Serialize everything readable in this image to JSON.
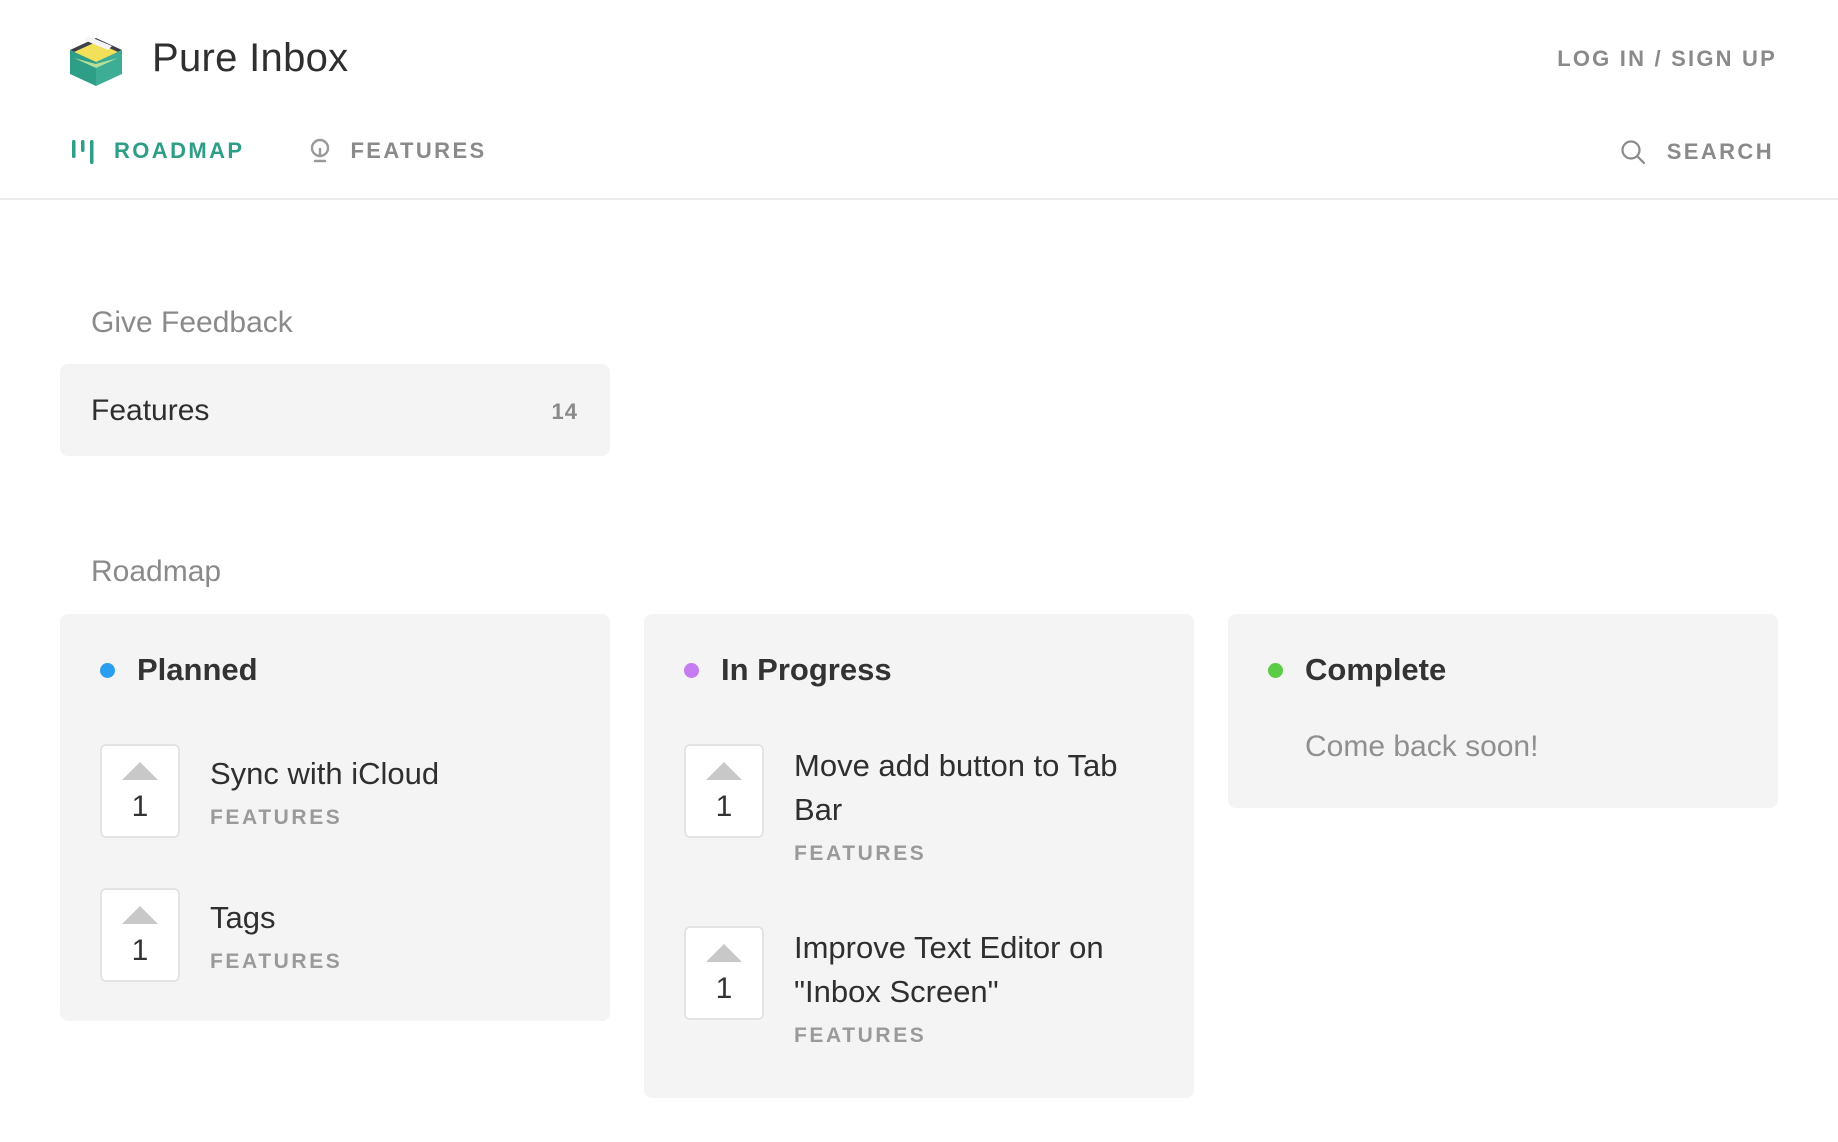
{
  "header": {
    "app_name": "Pure Inbox",
    "auth_label": "LOG IN / SIGN UP",
    "nav": [
      {
        "label": "ROADMAP",
        "icon": "roadmap-icon",
        "active": true
      },
      {
        "label": "FEATURES",
        "icon": "lightbulb-icon",
        "active": false
      }
    ],
    "search_label": "SEARCH"
  },
  "colors": {
    "accent": "#2f9e86",
    "planned": "#2b9ef0",
    "in_progress": "#c47cf0",
    "complete": "#5ccb45"
  },
  "feedback": {
    "title": "Give Feedback",
    "boards": [
      {
        "name": "Features",
        "count": "14"
      }
    ]
  },
  "roadmap": {
    "title": "Roadmap",
    "columns": [
      {
        "title": "Planned",
        "posts": [
          {
            "title": "Sync with iCloud",
            "votes": "1",
            "tag": "FEATURES"
          },
          {
            "title": "Tags",
            "votes": "1",
            "tag": "FEATURES"
          }
        ]
      },
      {
        "title": "In Progress",
        "posts": [
          {
            "title": "Move add button to Tab Bar",
            "votes": "1",
            "tag": "FEATURES"
          },
          {
            "title": "Improve Text Editor on \"Inbox Screen\"",
            "votes": "1",
            "tag": "FEATURES"
          }
        ]
      },
      {
        "title": "Complete",
        "empty_message": "Come back soon!",
        "posts": []
      }
    ]
  }
}
